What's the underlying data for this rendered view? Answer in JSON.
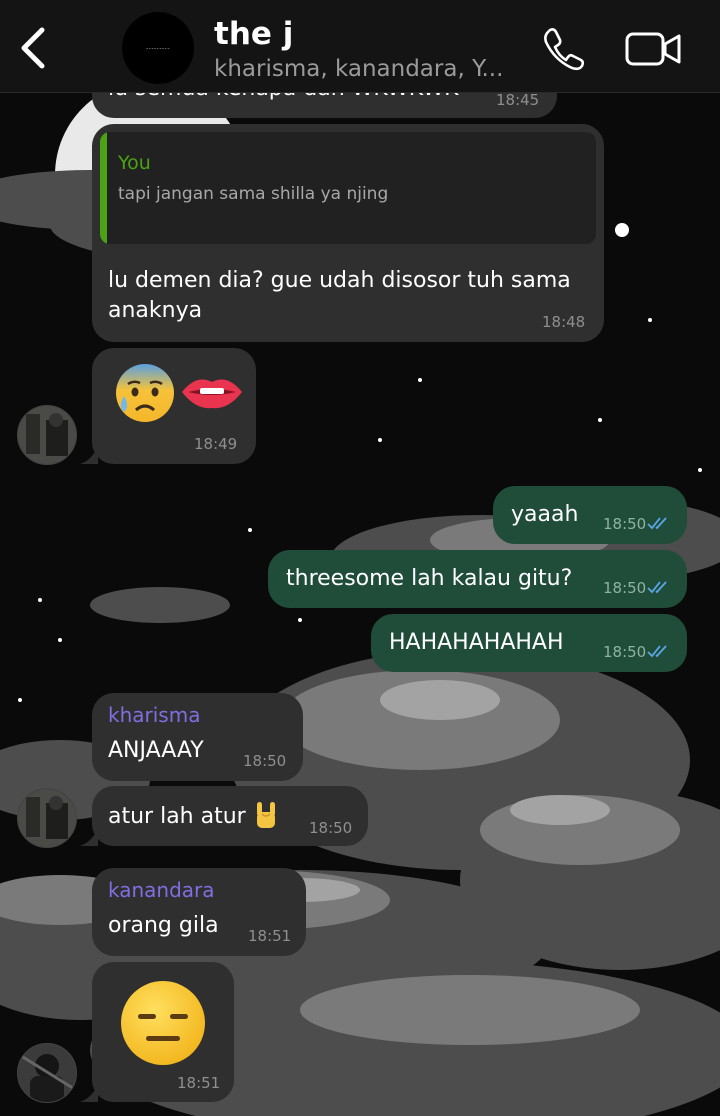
{
  "header": {
    "title": "the j",
    "subtitle": "kharisma, kanandara, Y...",
    "group_avatar_text": "---------",
    "back_icon": "chevron-left-icon",
    "call_icon": "phone-icon",
    "video_icon": "video-camera-icon"
  },
  "messages": {
    "m0": {
      "text": "lu semua kenapa dah WKWKWK",
      "time": "18:45"
    },
    "m1": {
      "quote_name": "You",
      "quote_text": "tapi jangan sama shilla ya njing",
      "text_line1": "lu demen dia? gue udah disosor tuh sama",
      "text_line2": "anaknya",
      "time": "18:48"
    },
    "m2": {
      "emoji": "anxious-face-with-sweat + biting-lip",
      "time": "18:49"
    },
    "m3": {
      "text": "yaaah",
      "time": "18:50"
    },
    "m4": {
      "text": "threesome lah kalau gitu?",
      "time": "18:50"
    },
    "m5": {
      "text": "HAHAHAHAHAH",
      "time": "18:50"
    },
    "m6": {
      "sender": "kharisma",
      "text": "ANJAAAY",
      "time": "18:50"
    },
    "m7": {
      "text": "atur lah atur",
      "time": "18:50",
      "emoji": "sign-of-the-horns"
    },
    "m8": {
      "sender": "kanandara",
      "text": "orang gila",
      "time": "18:51"
    },
    "m9": {
      "emoji": "expressionless-face",
      "time": "18:51"
    }
  },
  "colors": {
    "incoming_bubble": "#2f2f2f",
    "outgoing_bubble": "#1f4d3a",
    "quote_accent": "#4aa214",
    "sender_name": "#7f6fe0",
    "read_ticks": "#5aa9e6"
  }
}
